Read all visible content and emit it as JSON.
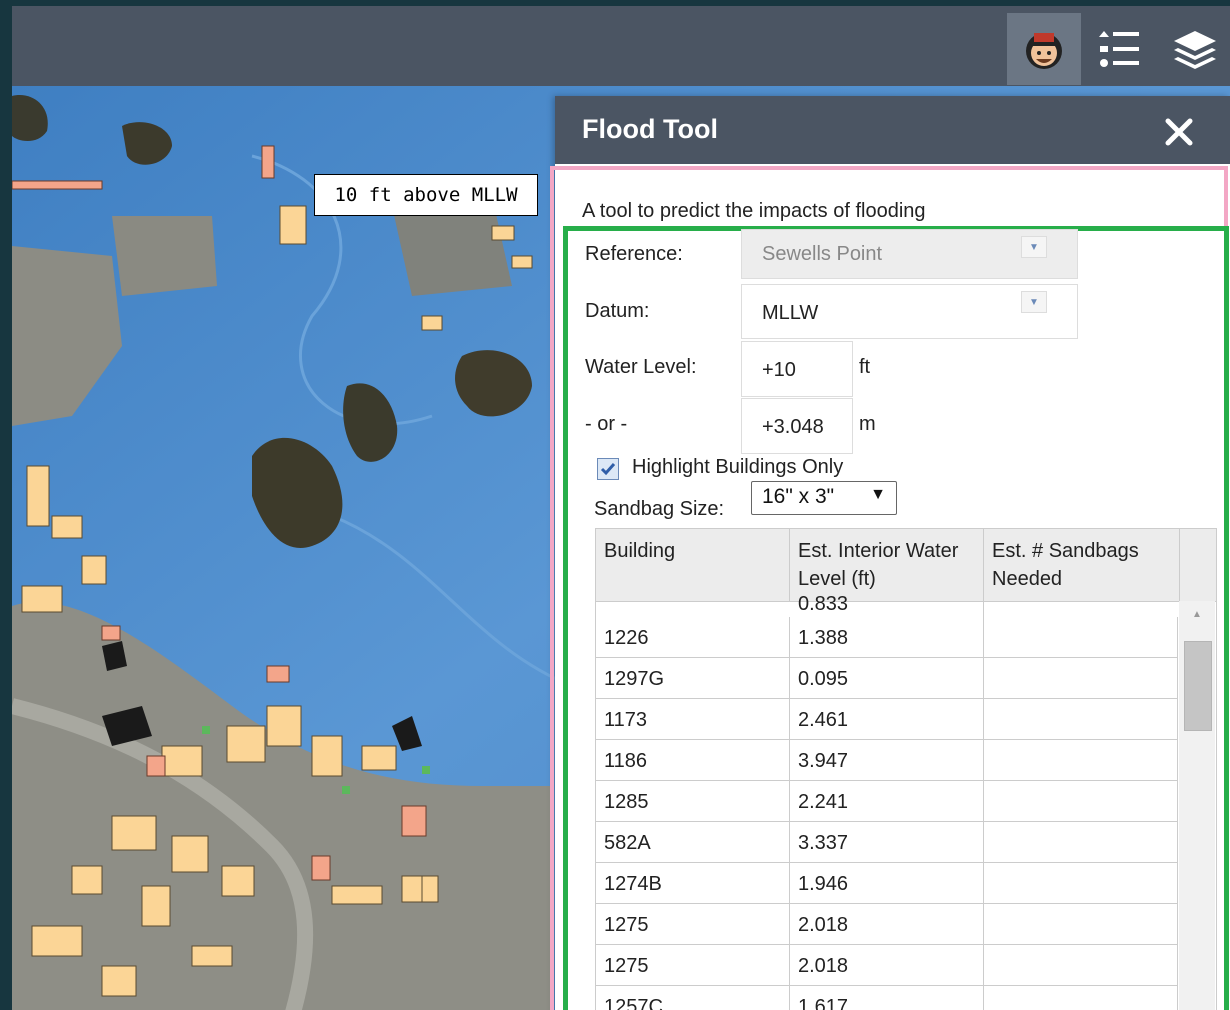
{
  "toolbar": {
    "icons": [
      "avatar-icon",
      "legend-icon",
      "layers-icon"
    ]
  },
  "map": {
    "label": "10 ft above MLLW"
  },
  "panel": {
    "title": "Flood Tool",
    "close_icon": "close-icon",
    "description": "A tool to predict the impacts of flooding",
    "reference": {
      "label": "Reference:",
      "value": "Sewells Point"
    },
    "datum": {
      "label": "Datum:",
      "value": "MLLW"
    },
    "water_level": {
      "label": "Water Level:",
      "value": "+10",
      "unit": "ft"
    },
    "or_level": {
      "label": "- or -",
      "value": "+3.048",
      "unit": "m"
    },
    "highlight": {
      "label": "Highlight Buildings Only",
      "checked": true
    },
    "sandbag": {
      "label": "Sandbag Size:",
      "value": "16\" x 3\""
    },
    "table": {
      "headers": [
        "Building",
        "Est. Interior Water Level (ft)",
        "Est. # Sandbags Needed"
      ],
      "partial_first_value": "0.833",
      "rows": [
        [
          "1226",
          "1.388",
          ""
        ],
        [
          "1297G",
          "0.095",
          ""
        ],
        [
          "1173",
          "2.461",
          ""
        ],
        [
          "1186",
          "3.947",
          ""
        ],
        [
          "1285",
          "2.241",
          ""
        ],
        [
          "582A",
          "3.337",
          ""
        ],
        [
          "1274B",
          "1.946",
          ""
        ],
        [
          "1275",
          "2.018",
          ""
        ],
        [
          "1275",
          "2.018",
          ""
        ],
        [
          "1257C",
          "1.617",
          ""
        ]
      ]
    }
  },
  "colors": {
    "header": "#4b5563",
    "water": "#4b89c8",
    "pink_frame": "#f3a7c5",
    "green_frame": "#27ae4a"
  }
}
